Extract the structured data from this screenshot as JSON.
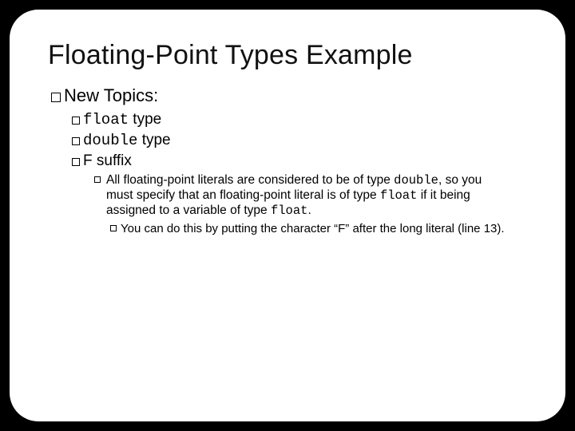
{
  "slide": {
    "title": "Floating-Point Types Example",
    "lvl1": {
      "text": "New Topics:"
    },
    "lvl2a": {
      "code": "float",
      "text": " type"
    },
    "lvl2b": {
      "code": "double",
      "text": " type"
    },
    "lvl2c": {
      "text": "F suffix"
    },
    "lvl3": {
      "p1": "All floating-point literals are considered to be of type ",
      "c1": "double",
      "p2": ", so you must specify that an floating-point literal is of type ",
      "c2": "float",
      "p3": " if it being assigned to a variable of type ",
      "c3": "float",
      "p4": "."
    },
    "lvl4": {
      "text": "You can do this by putting the character “F” after the long literal (line 13)."
    }
  }
}
